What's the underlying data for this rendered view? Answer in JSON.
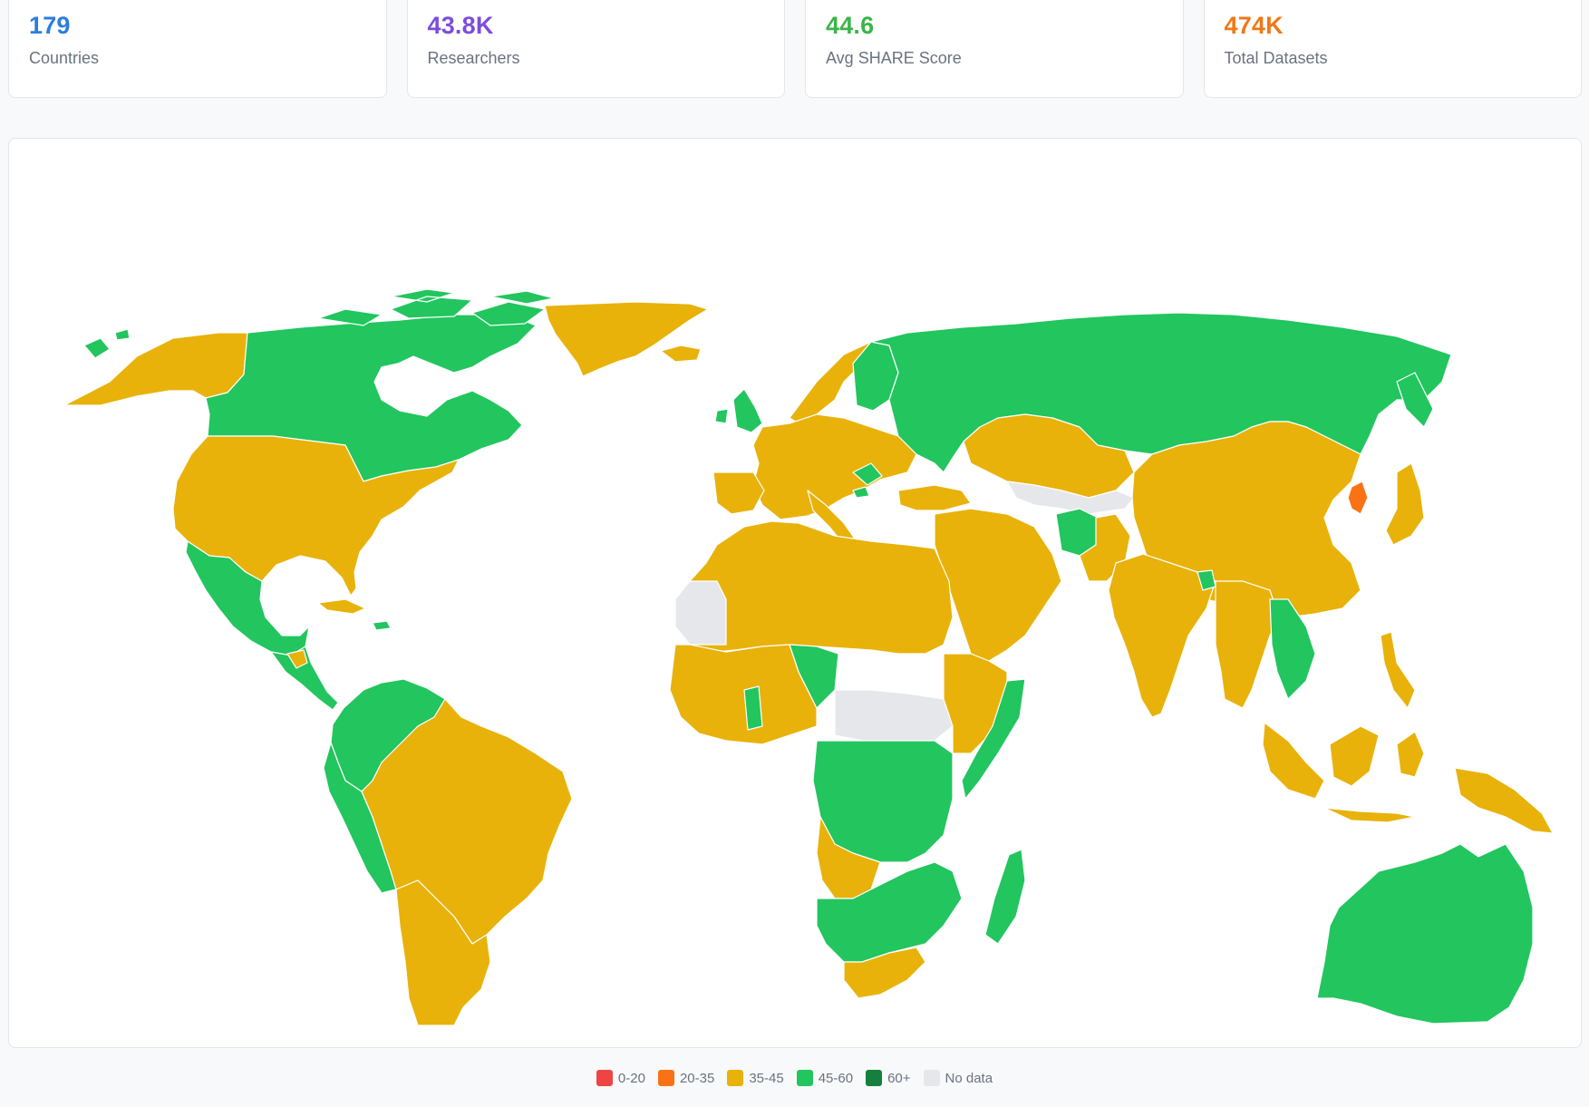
{
  "stats": [
    {
      "value": "179",
      "label": "Countries",
      "color": "#2b7de0"
    },
    {
      "value": "43.8K",
      "label": "Researchers",
      "color": "#7c4ddc"
    },
    {
      "value": "44.6",
      "label": "Avg SHARE Score",
      "color": "#3cb44b"
    },
    {
      "value": "474K",
      "label": "Total Datasets",
      "color": "#f07818"
    }
  ],
  "colors": {
    "score_35_45": "#e8b20a",
    "score_45_60": "#22c55e",
    "score_20_35": "#f97316",
    "no_data": "#e5e7eb"
  },
  "legend": [
    {
      "label": "0-20",
      "color": "#ef4444"
    },
    {
      "label": "20-35",
      "color": "#f97316"
    },
    {
      "label": "35-45",
      "color": "#e8b20a"
    },
    {
      "label": "45-60",
      "color": "#22c55e"
    },
    {
      "label": "60+",
      "color": "#15803d"
    },
    {
      "label": "No data",
      "color": "#e5e7eb"
    }
  ]
}
